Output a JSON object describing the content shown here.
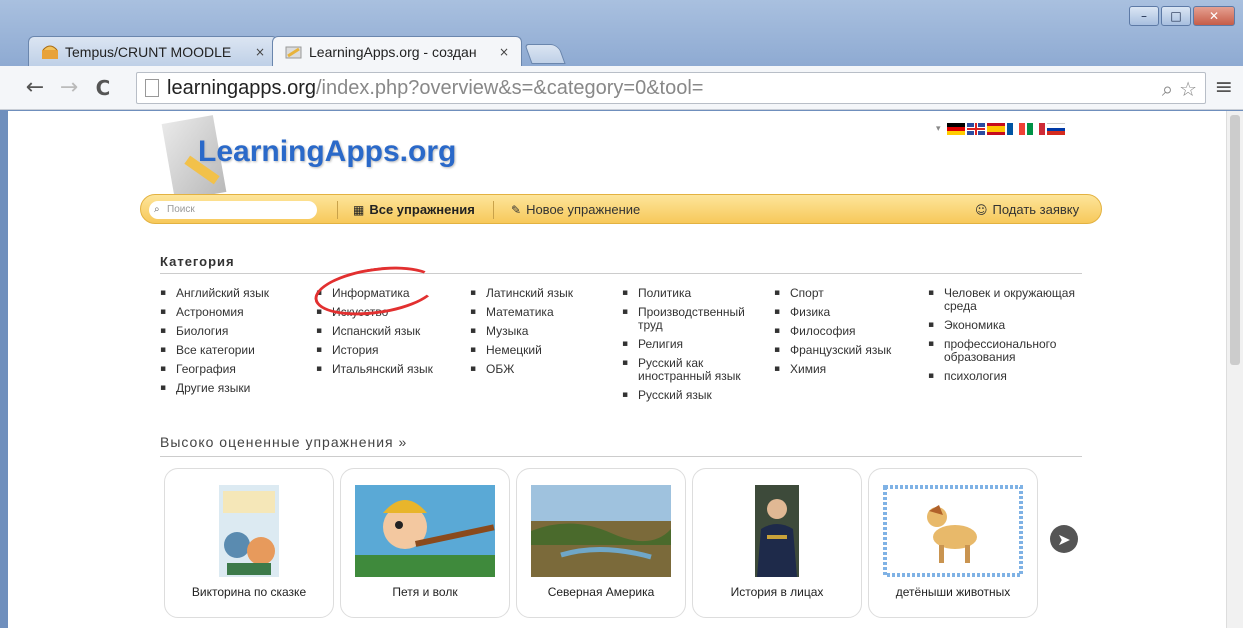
{
  "window": {
    "controls": {
      "minimize": "–",
      "maximize": "□",
      "close": "✕"
    }
  },
  "tabs": [
    {
      "title": "Tempus/CRUNT MOODLE",
      "close": "×",
      "icon": "moodle-favicon-icon",
      "active": false
    },
    {
      "title": "LearningApps.org - создан",
      "close": "×",
      "icon": "learningapps-favicon-icon",
      "active": true
    }
  ],
  "toolbar": {
    "back": "←",
    "forward": "→",
    "reload": "C",
    "url_host": "learningapps.org",
    "url_path": "/index.php?overview&s=&category=0&tool=",
    "zoom_icon": "⌕",
    "star_icon": "☆",
    "menu_icon": "≡"
  },
  "site": {
    "logo": "LearningApps.org",
    "languages": [
      "de",
      "en",
      "es",
      "fr",
      "it",
      "ru"
    ],
    "flag_arrow": "▾",
    "menu": {
      "search_placeholder": "Поиск",
      "search_icon": "⌕",
      "all_apps_icon": "▦",
      "all_apps": "Все упражнения",
      "new_app_icon": "✎",
      "new_app": "Новое упражнение",
      "apply_icon": "☺",
      "apply": "Подать заявку"
    }
  },
  "category": {
    "title": "Категория",
    "columns": [
      [
        "Английский язык",
        "Астрономия",
        "Биология",
        "Все категории",
        "География",
        "Другие языки"
      ],
      [
        "Информатика",
        "Искусство",
        "Испанский язык",
        "История",
        "Итальянский язык"
      ],
      [
        "Латинский язык",
        "Математика",
        "Музыка",
        "Немецкий",
        "ОБЖ"
      ],
      [
        "Политика",
        "Производственный труд",
        "Религия",
        "Русский как иностранный язык",
        "Русский язык"
      ],
      [
        "Спорт",
        "Физика",
        "Философия",
        "Французский язык",
        "Химия"
      ],
      [
        "Человек и окружающая среда",
        "Экономика",
        "профессионального образования",
        "психология"
      ]
    ]
  },
  "highly_rated": {
    "title": "Высоко оцененные упражнения »",
    "cards": [
      {
        "label": "Викторина по сказке"
      },
      {
        "label": "Петя и волк"
      },
      {
        "label": "Северная Америка"
      },
      {
        "label": "История в лицах"
      },
      {
        "label": "детёныши животных"
      }
    ],
    "next_icon": "➤"
  }
}
